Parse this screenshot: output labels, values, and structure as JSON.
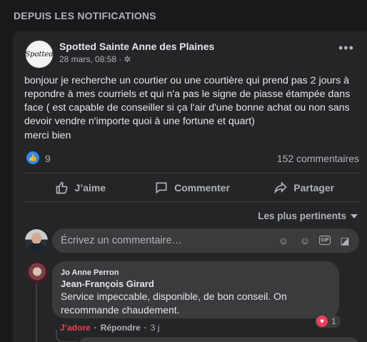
{
  "section": {
    "title": "DEPUIS LES NOTIFICATIONS"
  },
  "post": {
    "page_name": "Spotted Sainte Anne des Plaines",
    "logo_text": "Spotted",
    "date": "28 mars, 08:58 ·",
    "privacy_icon": "gear-icon",
    "body": "bonjour je recherche un courtier ou une courtière qui prend pas 2 jours à repondre à mes courriels et qui n'a pas le signe de piasse étampée dans face ( est capable de conseiller si ça l'air d'une bonne achat ou non sans devoir vendre n'importe quoi à une fortune et quart)",
    "signoff": "merci bien",
    "likes": "9",
    "comments_count": "152 commentaires"
  },
  "actions": {
    "like": "J’aime",
    "comment": "Commenter",
    "share": "Partager"
  },
  "sort": {
    "label": "Les plus pertinents"
  },
  "composer": {
    "placeholder": "Écrivez un commentaire…"
  },
  "comment": {
    "author": "Jo Anne Perron",
    "tag": "Jean-François Girard",
    "text": "Service impeccable, disponible, de bon conseil. On recommande chaudement.",
    "reaction_count": "1",
    "love_label": "J’adore",
    "reply_label": "Répondre",
    "time": "3 j"
  },
  "colors": {
    "accent": "#2d88ff",
    "love": "#f33e58",
    "bg": "#18191a",
    "card": "#242526"
  }
}
